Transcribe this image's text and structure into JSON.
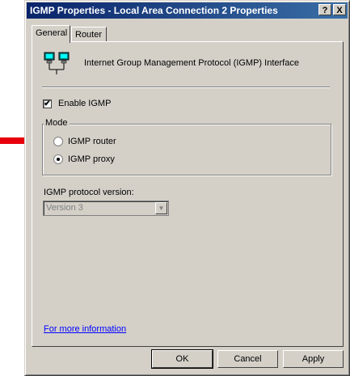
{
  "window": {
    "title": "IGMP Properties - Local Area Connection 2 Properties",
    "help_label": "?",
    "close_label": "X"
  },
  "tabs": [
    {
      "label": "General"
    },
    {
      "label": "Router"
    }
  ],
  "general": {
    "header_text": "Internet Group Management Protocol (IGMP) Interface",
    "enable_igmp": {
      "label": "Enable IGMP",
      "checked": true,
      "mark": "✔"
    },
    "mode": {
      "legend": "Mode",
      "options": [
        {
          "label": "IGMP router",
          "checked": false
        },
        {
          "label": "IGMP proxy",
          "checked": true
        }
      ]
    },
    "version": {
      "label": "IGMP protocol version:",
      "value": "Version 3",
      "disabled": true
    },
    "more_info_link": "For more information"
  },
  "buttons": {
    "ok": "OK",
    "cancel": "Cancel",
    "apply": "Apply"
  },
  "annotation": {
    "arrow_color": "#e8000c",
    "points_to": "IGMP router"
  },
  "colors": {
    "title_start": "#0a246a",
    "title_end": "#3a6ea5",
    "face": "#d4d0c8",
    "link": "#0000ff"
  }
}
